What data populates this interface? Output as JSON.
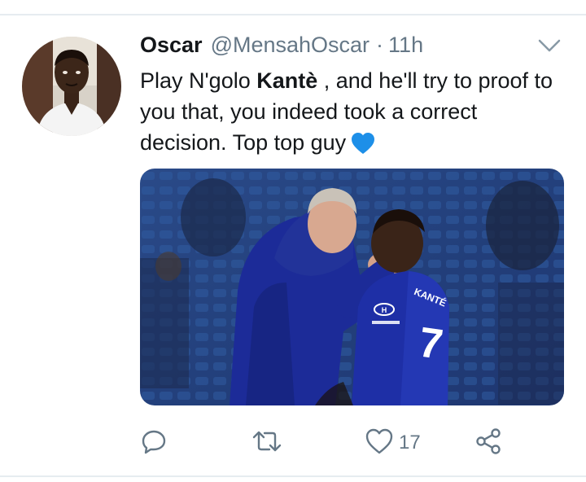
{
  "tweet": {
    "author_name": "Oscar",
    "author_handle": "@MensahOscar",
    "separator": "·",
    "timestamp": "11h",
    "text_part1": "Play N'golo ",
    "text_bold": "Kantè",
    "text_part2": " , and he'll try to proof to you that, you indeed took a correct decision. Top top guy",
    "emoji": "blue-heart",
    "media": {
      "jersey_name": "KANTÉ",
      "jersey_number": "7",
      "kit_color": "#1c2fa0"
    }
  },
  "actions": {
    "reply_icon": "reply-icon",
    "retweet_icon": "retweet-icon",
    "like_icon": "heart-icon",
    "like_count": "17",
    "share_icon": "share-icon"
  },
  "colors": {
    "text": "#14171a",
    "secondary": "#657786",
    "divider": "#e6ecf0",
    "emoji_blue": "#1d8fe8"
  }
}
